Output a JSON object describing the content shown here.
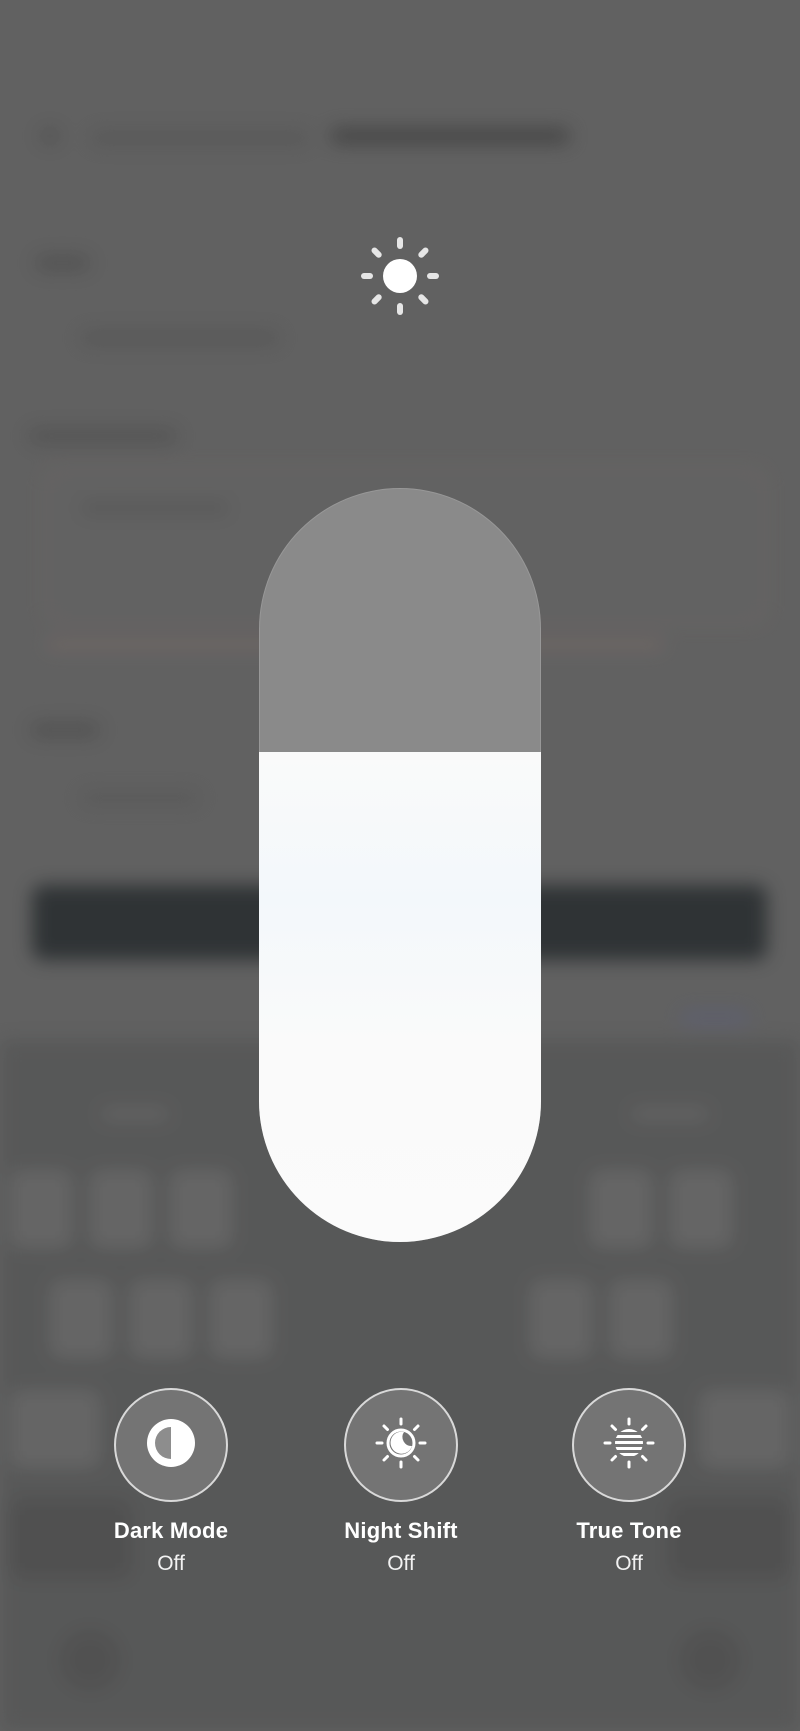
{
  "brightness": {
    "level_percent": 65,
    "icon": "sun-icon"
  },
  "controls": [
    {
      "label": "Dark Mode",
      "state": "Off",
      "icon": "dark-mode-icon"
    },
    {
      "label": "Night Shift",
      "state": "Off",
      "icon": "night-shift-icon"
    },
    {
      "label": "True Tone",
      "state": "Off",
      "icon": "true-tone-icon"
    }
  ],
  "colors": {
    "slider_track": "#8a8a8a",
    "slider_fill": "#fafafa",
    "background_dim": "#636363"
  }
}
